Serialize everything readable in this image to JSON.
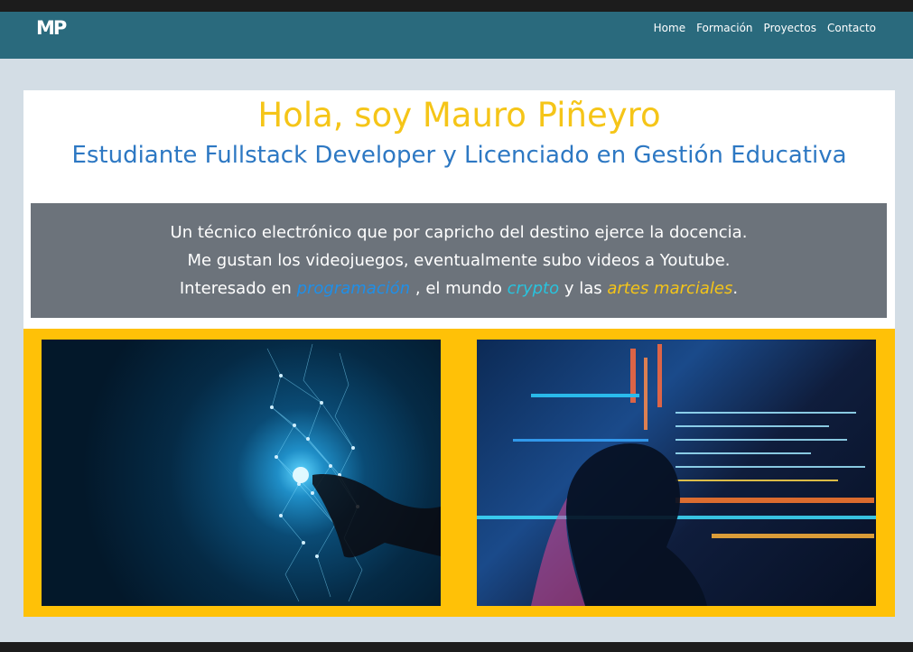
{
  "brand": {
    "logo_text": "MP"
  },
  "nav": {
    "items": [
      {
        "label": "Home"
      },
      {
        "label": "Formación"
      },
      {
        "label": "Proyectos"
      },
      {
        "label": "Contacto"
      }
    ]
  },
  "hero": {
    "title": "Hola, soy Mauro Piñeyro",
    "subtitle": "Estudiante Fullstack Developer y Licenciado en Gestión Educativa"
  },
  "bio": {
    "line1": "Un técnico electrónico que por capricho del destino ejerce la docencia.",
    "line2": "Me gustan los videojuegos, eventualmente subo videos a Youtube.",
    "line3_prefix": "Interesado en",
    "interest_programming": "programación",
    "line3_middle": ", el mundo",
    "interest_crypto": "crypto",
    "line3_and": "y las",
    "interest_arts": "artes marciales",
    "line3_end": "."
  },
  "colors": {
    "navbar": "#2a6a7d",
    "title_yellow": "#f5c518",
    "subtitle_blue": "#2d78c3",
    "bio_bg": "#6c737b",
    "gallery_bg": "#ffc107",
    "page_bg": "#d3dde5"
  },
  "gallery": {
    "images": [
      {
        "icon": "ai-network-hand-image"
      },
      {
        "icon": "code-silhouette-image"
      }
    ]
  }
}
